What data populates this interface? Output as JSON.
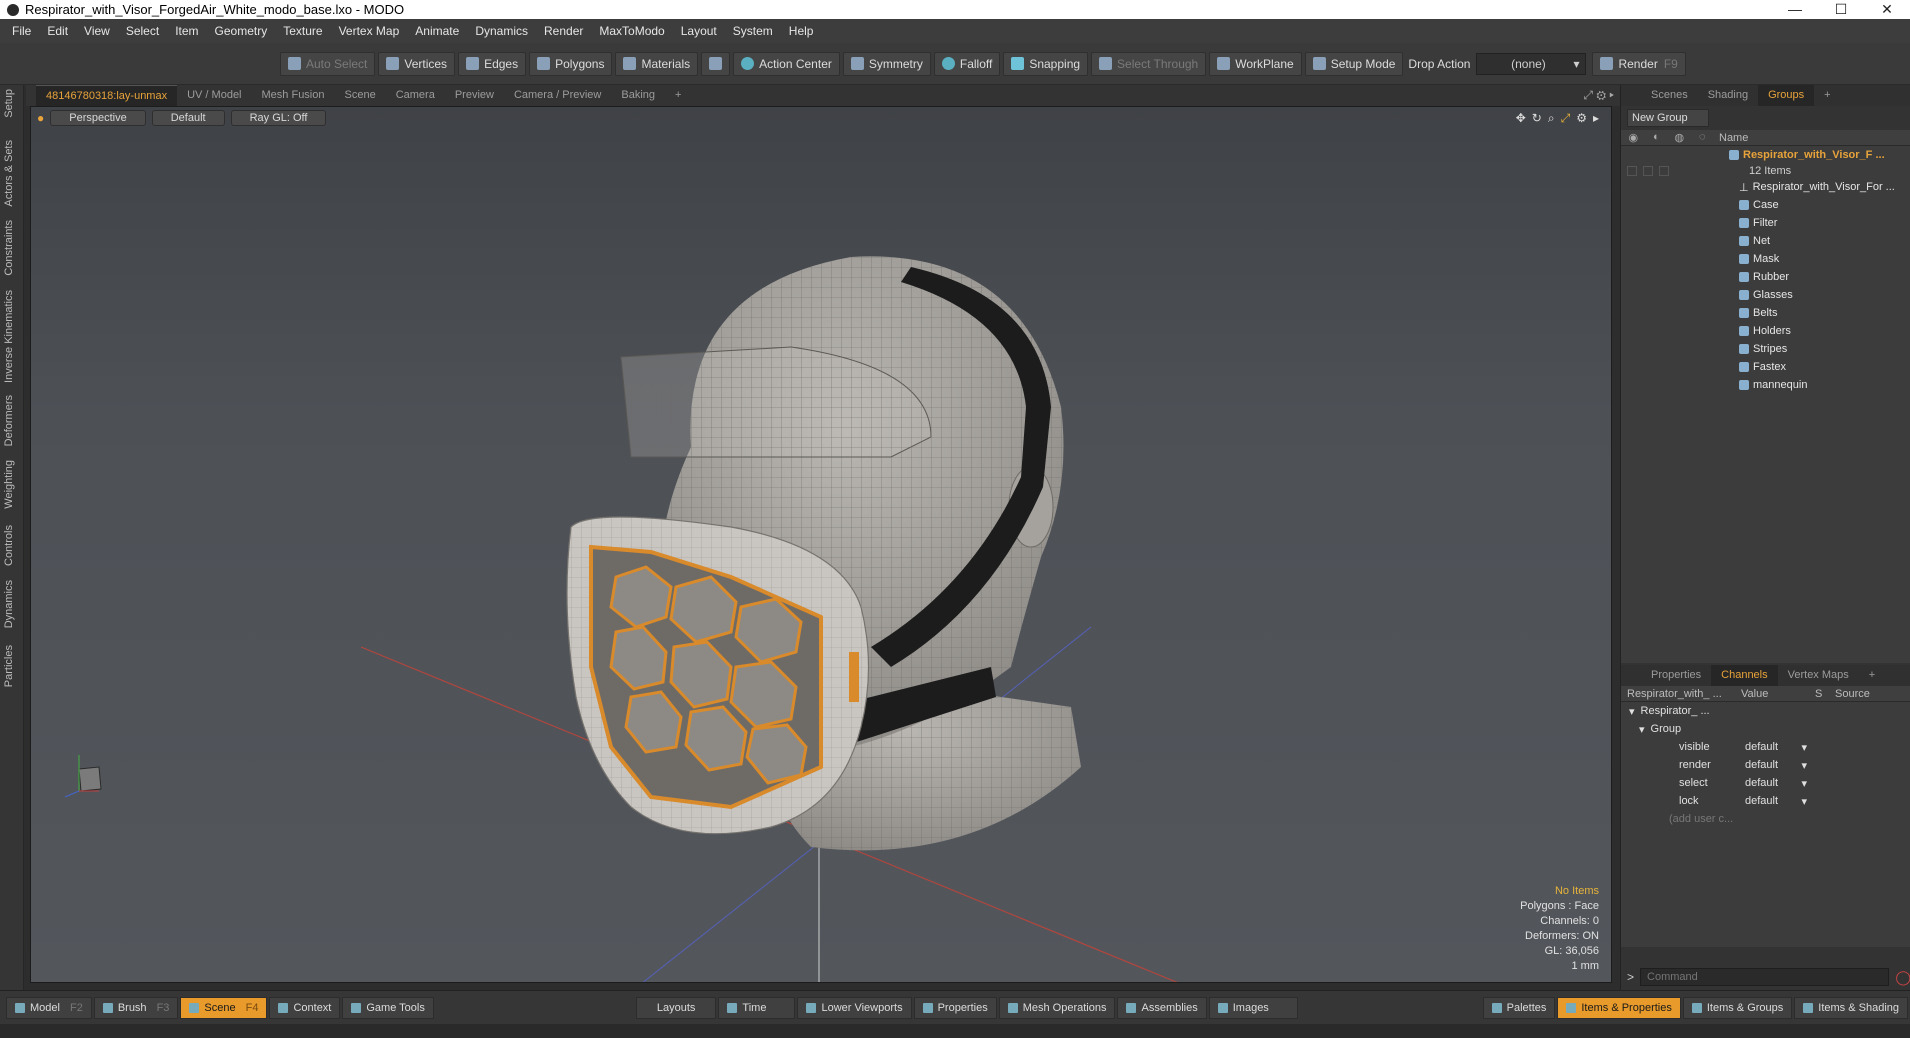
{
  "window": {
    "title": "Respirator_with_Visor_ForgedAir_White_modo_base.lxo - MODO",
    "minimize": "—",
    "maximize": "☐",
    "close": "✕"
  },
  "menu": [
    "File",
    "Edit",
    "View",
    "Select",
    "Item",
    "Geometry",
    "Texture",
    "Vertex Map",
    "Animate",
    "Dynamics",
    "Render",
    "MaxToModo",
    "Layout",
    "System",
    "Help"
  ],
  "toolbar": {
    "auto_select": "Auto Select",
    "vertices": "Vertices",
    "edges": "Edges",
    "polygons": "Polygons",
    "materials": "Materials",
    "action_center": "Action Center",
    "symmetry": "Symmetry",
    "falloff": "Falloff",
    "snapping": "Snapping",
    "select_through": "Select Through",
    "workplane": "WorkPlane",
    "setup_mode": "Setup Mode",
    "drop_action_label": "Drop Action",
    "drop_action_value": "(none)",
    "render": "Render",
    "render_key": "F9"
  },
  "left_rail": [
    "Setup",
    "Actors & Sets",
    "Constraints",
    "Inverse Kinematics",
    "Deformers",
    "Weighting",
    "Controls",
    "Dynamics",
    "Particles"
  ],
  "viewport_tabs": {
    "active": "48146780318:lay-unmax",
    "items": [
      "UV / Model",
      "Mesh Fusion",
      "Scene",
      "Camera",
      "Preview",
      "Camera / Preview",
      "Baking"
    ],
    "add": "+"
  },
  "viewport": {
    "projection": "Perspective",
    "shading": "Default",
    "raygl": "Ray GL: Off",
    "readout": {
      "items": "No Items",
      "polygons": "Polygons : Face",
      "channels": "Channels: 0",
      "deformers": "Deformers: ON",
      "gl": "GL: 36,056",
      "scale": "1 mm"
    }
  },
  "right_tabs": {
    "items": [
      "Scenes",
      "Shading",
      "Groups"
    ],
    "active": "Groups",
    "add": "+"
  },
  "groups": {
    "new_group": "New Group",
    "name_col": "Name",
    "root": "Respirator_with_Visor_F ...",
    "count": "12 Items",
    "children": [
      "Respirator_with_Visor_For ...",
      "Case",
      "Filter",
      "Net",
      "Mask",
      "Rubber",
      "Glasses",
      "Belts",
      "Holders",
      "Stripes",
      "Fastex",
      "mannequin"
    ]
  },
  "channel_tabs": {
    "items": [
      "Properties",
      "Channels",
      "Vertex Maps"
    ],
    "active": "Channels",
    "add": "+"
  },
  "channels": {
    "col_name": "Respirator_with_ ...",
    "col_value": "Value",
    "col_s": "S",
    "col_source": "Source",
    "tree_root": "Respirator_ ...",
    "tree_group": "Group",
    "rows": [
      {
        "name": "visible",
        "value": "default"
      },
      {
        "name": "render",
        "value": "default"
      },
      {
        "name": "select",
        "value": "default"
      },
      {
        "name": "lock",
        "value": "default"
      }
    ],
    "add_user": "(add user c..."
  },
  "command": {
    "prompt": ">",
    "placeholder": "Command"
  },
  "status_left": [
    {
      "label": "Model",
      "key": "F2"
    },
    {
      "label": "Brush",
      "key": "F3"
    },
    {
      "label": "Scene",
      "key": "F4",
      "active": true
    },
    {
      "label": "Context",
      "key": ""
    },
    {
      "label": "Game Tools",
      "key": ""
    }
  ],
  "status_center": [
    "Layouts",
    "Time",
    "Lower Viewports",
    "Properties",
    "Mesh Operations",
    "Assemblies",
    "Images"
  ],
  "status_right": [
    "Palettes",
    "Items & Properties",
    "Items & Groups",
    "Items & Shading"
  ],
  "colors": {
    "accent": "#e89a2a",
    "highlight": "#e8b33a",
    "mesh": "#a9a6a1",
    "filter": "#d98a2b",
    "strap": "#1c1c1c"
  }
}
